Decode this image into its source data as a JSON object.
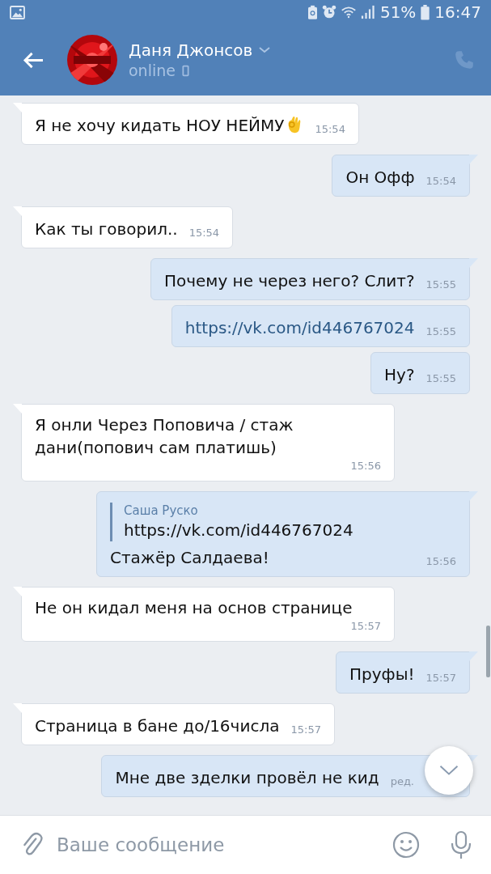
{
  "status_bar": {
    "battery": "51%",
    "time": "16:47"
  },
  "header": {
    "name": "Даня Джонсов",
    "status": "online"
  },
  "messages": [
    {
      "outgoing": false,
      "tail": true,
      "text": "Я не хочу кидать НОУ НЕЙМУ",
      "emoji": true,
      "time": "15:54"
    },
    {
      "outgoing": true,
      "tail": true,
      "text": "Он Офф",
      "time": "15:54"
    },
    {
      "outgoing": false,
      "tail": true,
      "text": "Как ты говорил..",
      "time": "15:54"
    },
    {
      "outgoing": true,
      "tail": true,
      "text": "Почему не через него? Слит?",
      "time": "15:55"
    },
    {
      "outgoing": true,
      "tail": false,
      "text": "https://vk.com/id446767024",
      "link": true,
      "time": "15:55"
    },
    {
      "outgoing": true,
      "tail": false,
      "text": "Ну?",
      "time": "15:55"
    },
    {
      "outgoing": false,
      "tail": true,
      "text": "Я онли Через Поповича / стаж дани(попович сам платишь)",
      "time": "15:56"
    },
    {
      "outgoing": true,
      "tail": true,
      "quote": {
        "author": "Саша Руско",
        "text": "https://vk.com/id446767024"
      },
      "text": "Стажёр Салдаева!",
      "time": "15:56"
    },
    {
      "outgoing": false,
      "tail": true,
      "text": "Не он кидал меня на основ странице",
      "time": "15:57"
    },
    {
      "outgoing": true,
      "tail": true,
      "text": "Пруфы!",
      "time": "15:57"
    },
    {
      "outgoing": false,
      "tail": true,
      "text": "Страница в бане до/16числа",
      "time": "15:57"
    },
    {
      "outgoing": true,
      "tail": true,
      "text": "Мне две зделки провёл не кид",
      "time": "ред.",
      "covered": true
    }
  ],
  "composer": {
    "placeholder": "Ваше сообщение"
  }
}
